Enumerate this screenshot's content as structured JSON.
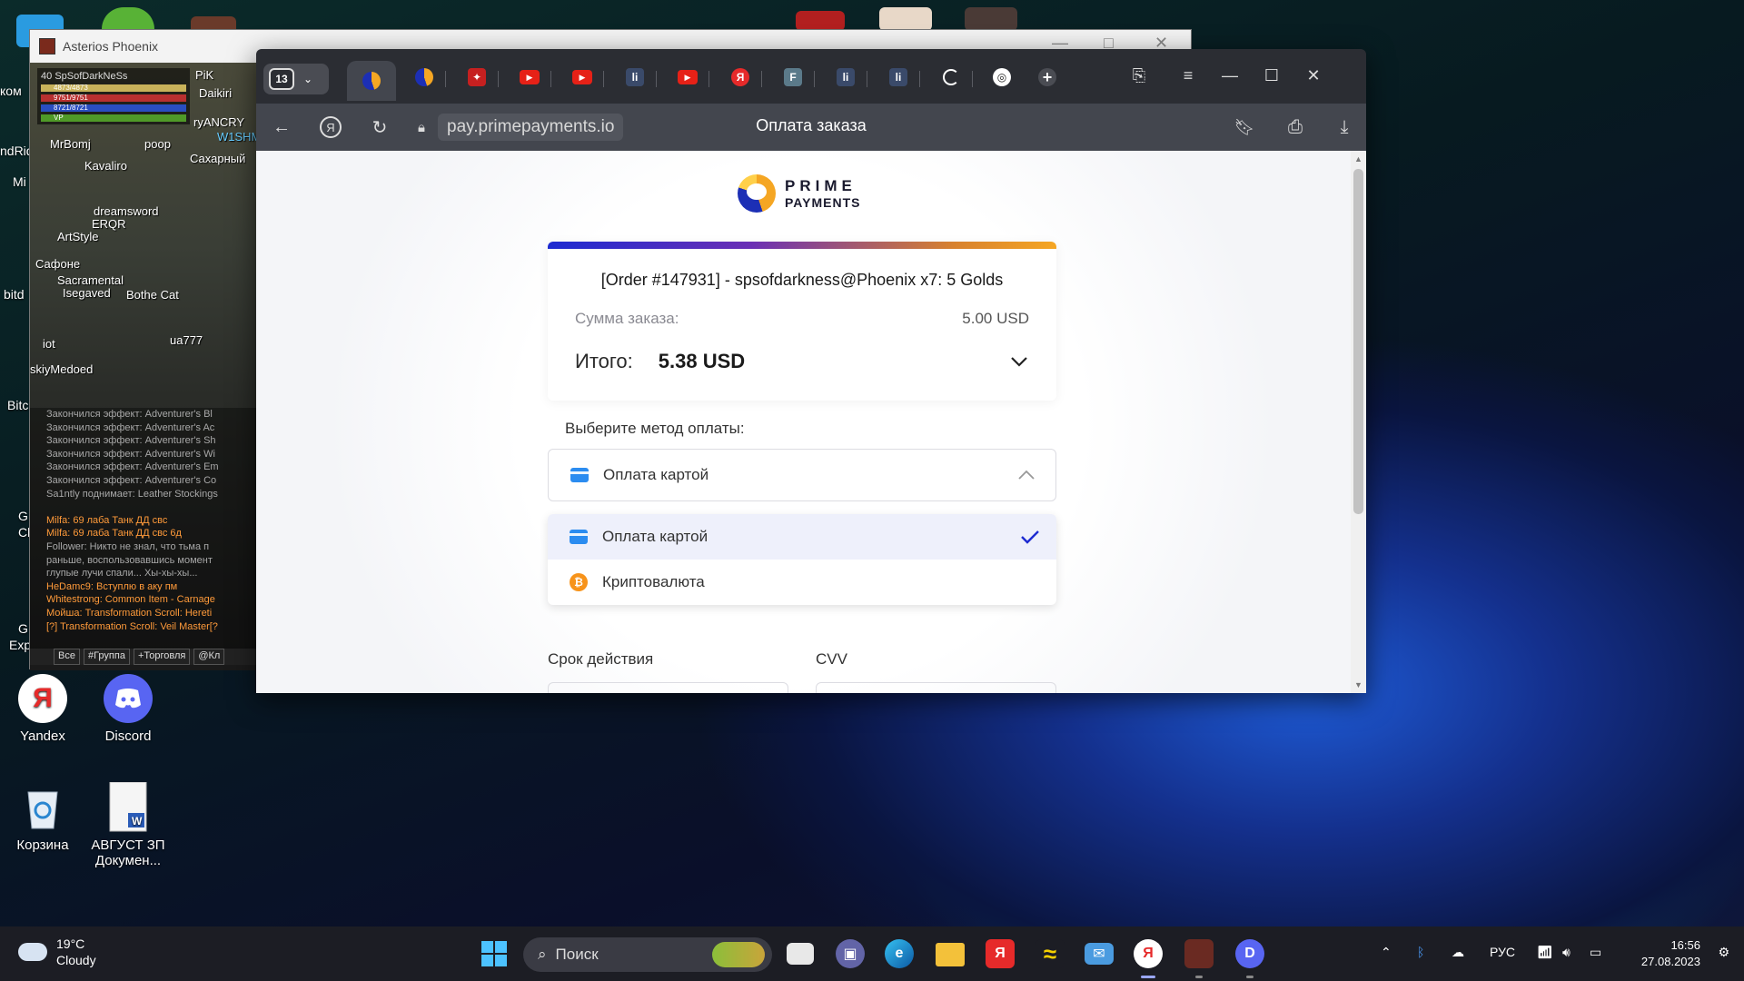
{
  "desktop": {
    "icons": [
      {
        "label": "Yandex",
        "glyph": "Я",
        "color": "#ffffff"
      },
      {
        "label": "Discord",
        "glyph": "D",
        "color": "#5865f2"
      },
      {
        "label": "Корзина",
        "glyph": "♲",
        "color": "#dfe8f3"
      },
      {
        "label": "АВГУСТ ЗП Докумен...",
        "glyph": "W",
        "color": "#ffffff"
      }
    ],
    "partial_labels": [
      "ком",
      "ndRider",
      "Mi",
      "bitd",
      "Bitc",
      "G",
      "Cl",
      "G",
      "Exp"
    ]
  },
  "game": {
    "window_title": "Asterios Phoenix",
    "player": {
      "level": "40",
      "name": "SpSofDarkNeSs",
      "cp": "4873/4873",
      "hp": "9751/9751",
      "mp": "8721/8721",
      "vp": "VP"
    },
    "nicknames": [
      "PiK",
      "Daikiri",
      "ryANCRY",
      "W1SHM",
      "MrBomj",
      "poop",
      "Сахарный",
      "Kavaliro",
      "dreamsword",
      "ERQR",
      "ArtStyle",
      "Сафоне",
      "Sacramental",
      "Isegaved",
      "Bothe Cat",
      "ua777",
      "iot",
      "skiyMedoed"
    ],
    "chat": [
      {
        "text": "Закончился эффект: Adventurer's Bl",
        "kind": "sys"
      },
      {
        "text": "Закончился эффект: Adventurer's Ac",
        "kind": "sys"
      },
      {
        "text": "Закончился эффект: Adventurer's Sh",
        "kind": "sys"
      },
      {
        "text": "Закончился эффект: Adventurer's Wi",
        "kind": "sys"
      },
      {
        "text": "Закончился эффект: Adventurer's Em",
        "kind": "sys"
      },
      {
        "text": "Закончился эффект: Adventurer's Co",
        "kind": "sys"
      },
      {
        "text": "Sa1ntly поднимает: Leather Stockings",
        "kind": "sys"
      },
      {
        "text": "",
        "kind": "sys"
      },
      {
        "text": "Milfa: 69 лаба Танк ДД  свс",
        "kind": "orange"
      },
      {
        "text": "Milfa: 69 лаба Танк ДД  свс 6д",
        "kind": "orange"
      },
      {
        "text": "Follower: Никто не знал, что тьма п",
        "kind": "sys"
      },
      {
        "text": "раньше, воспользовавшись момент",
        "kind": "sys"
      },
      {
        "text": "глупые лучи спали... Хы-хы-хы...",
        "kind": "sys"
      },
      {
        "text": "HeDamc9: Вступлю в аку пм",
        "kind": "orange"
      },
      {
        "text": "Whitestrong: Common Item - Carnage",
        "kind": "orange"
      },
      {
        "text": "Мойша: Transformation Scroll: Hereti",
        "kind": "orange"
      },
      {
        "text": "[?] Transformation Scroll: Veil Master[?",
        "kind": "orange"
      }
    ],
    "chat_tabs": [
      "Все",
      "#Группа",
      "+Торговля",
      "@Кл"
    ]
  },
  "browser": {
    "tab_count": "13",
    "url": "pay.primepayments.io",
    "page_title": "Оплата заказа"
  },
  "payment": {
    "logo_line1": "PRIME",
    "logo_line2": "PAYMENTS",
    "order_title": "[Order #147931] - spsofdarkness@Phoenix x7: 5 Golds",
    "sum_label": "Сумма заказа:",
    "sum_value": "5.00 USD",
    "total_label": "Итого:",
    "total_value": "5.38 USD",
    "method_label": "Выберите метод оплаты:",
    "selected_method": "Оплата картой",
    "options": [
      "Оплата картой",
      "Криптовалюта"
    ],
    "expiry_label": "Срок действия",
    "cvv_label": "CVV"
  },
  "taskbar": {
    "temperature": "19°C",
    "condition": "Cloudy",
    "search_placeholder": "Поиск",
    "language": "РУС",
    "time": "16:56",
    "date": "27.08.2023"
  },
  "colors": {
    "accent": "#1d2bd1",
    "brand_orange": "#f5a623",
    "select_highlight": "#eef0fb"
  }
}
